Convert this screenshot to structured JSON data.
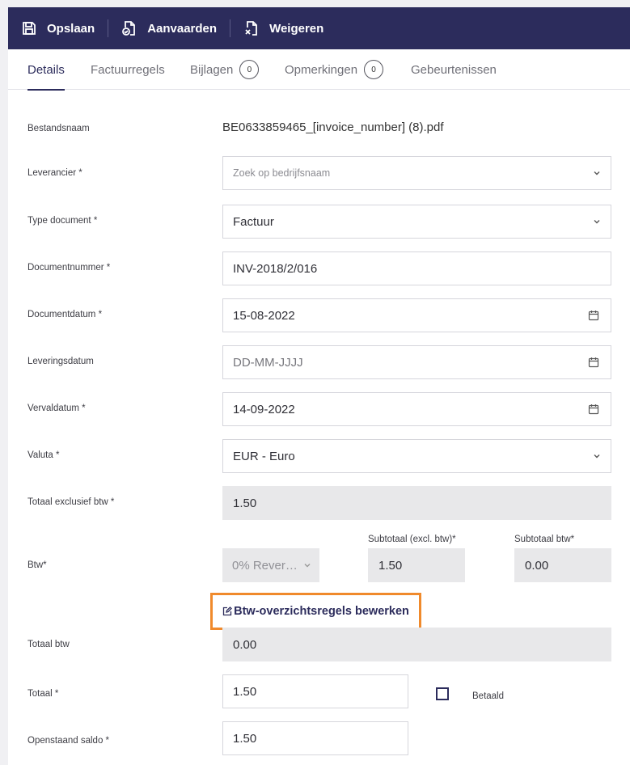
{
  "toolbar": {
    "save_label": "Opslaan",
    "accept_label": "Aanvaarden",
    "reject_label": "Weigeren"
  },
  "tabs": [
    {
      "label": "Details"
    },
    {
      "label": "Factuurregels"
    },
    {
      "label": "Bijlagen",
      "badge": "0"
    },
    {
      "label": "Opmerkingen",
      "badge": "0"
    },
    {
      "label": "Gebeurtenissen"
    }
  ],
  "form": {
    "filename_label": "Bestandsnaam",
    "filename_value": "BE0633859465_[invoice_number] (8).pdf",
    "supplier_label": "Leverancier *",
    "supplier_placeholder": "Zoek op bedrijfsnaam",
    "doctype_label": "Type document *",
    "doctype_value": "Factuur",
    "docnumber_label": "Documentnummer *",
    "docnumber_value": "INV-2018/2/016",
    "docdate_label": "Documentdatum *",
    "docdate_value": "15-08-2022",
    "deliverydate_label": "Leveringsdatum",
    "deliverydate_placeholder": "DD-MM-JJJJ",
    "duedate_label": "Vervaldatum *",
    "duedate_value": "14-09-2022",
    "currency_label": "Valuta *",
    "currency_value": "EUR - Euro",
    "total_excl_label": "Totaal exclusief btw *",
    "total_excl_value": "1.50",
    "vat_label": "Btw*",
    "vat_rate_value": "0% Rever…",
    "subtotal_excl_label": "Subtotaal (excl. btw)*",
    "subtotal_excl_value": "1.50",
    "subtotal_vat_label": "Subtotaal btw*",
    "subtotal_vat_value": "0.00",
    "edit_vat_lines_label": "Btw-overzichtsregels bewerken",
    "total_vat_label": "Totaal btw",
    "total_vat_value": "0.00",
    "total_label": "Totaal *",
    "total_value": "1.50",
    "paid_label": "Betaald",
    "balance_label": "Openstaand saldo *",
    "balance_value": "1.50"
  },
  "colors": {
    "toolbar_bg": "#2c2c5c",
    "accent": "#2c2c5c",
    "highlight_border": "#f08a2c",
    "readonly_bg": "#e8e8ea"
  }
}
